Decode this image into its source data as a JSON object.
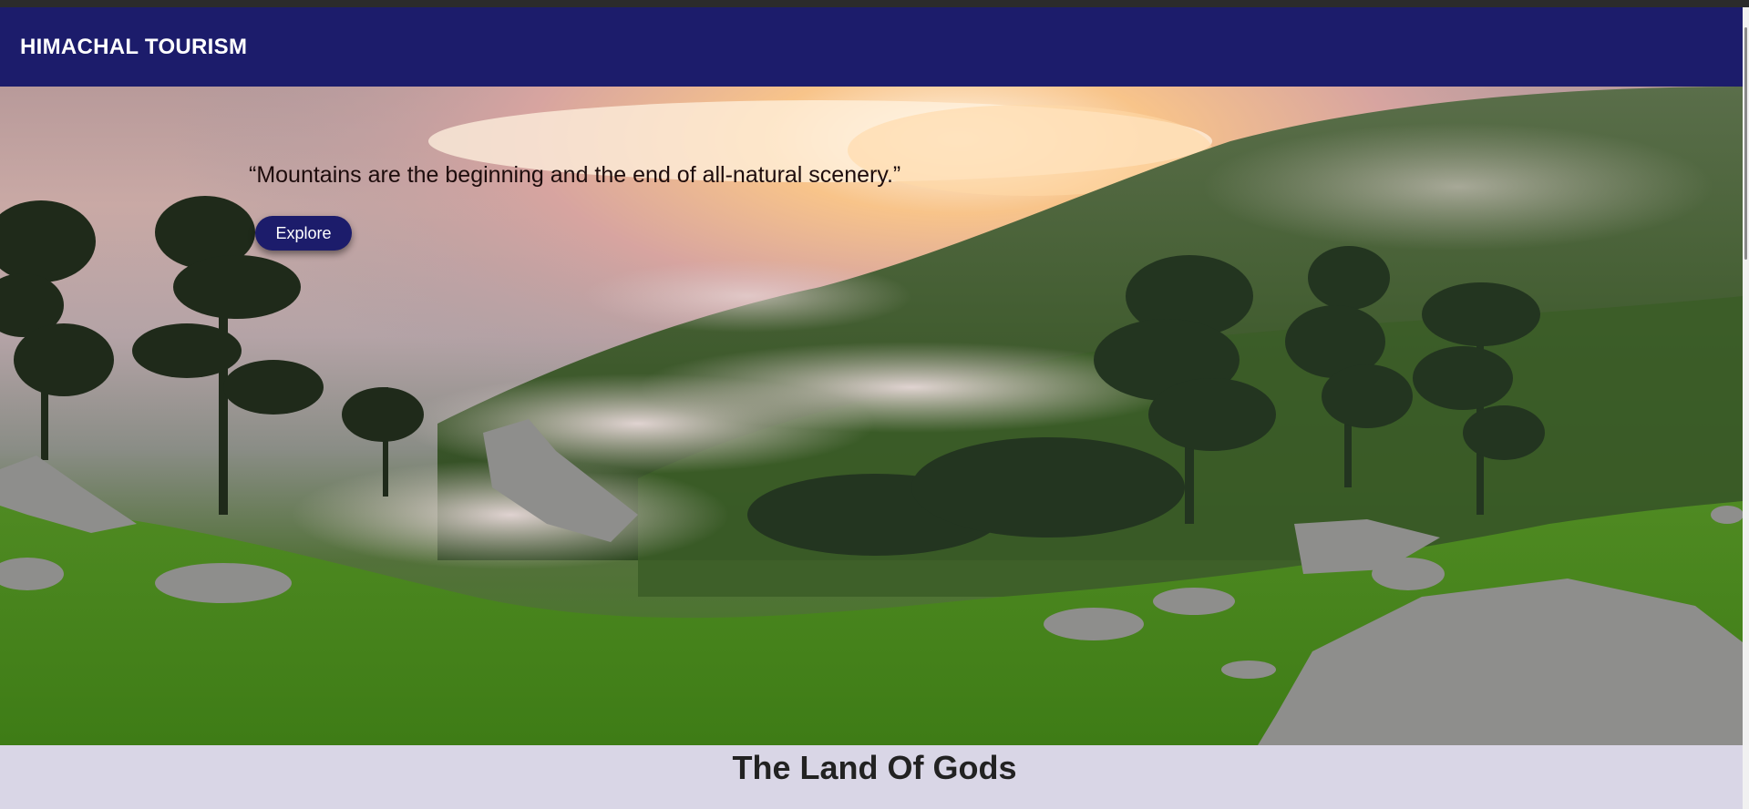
{
  "header": {
    "brand": "HIMACHAL TOURISM"
  },
  "hero": {
    "quote": "“Mountains are the beginning and the end of all-natural scenery.”",
    "explore_label": "Explore"
  },
  "section": {
    "title": "The Land Of Gods"
  },
  "colors": {
    "navbar": "#1c1c6b",
    "button": "#1c1c6b",
    "page_background": "#d9d6e6",
    "quote_text": "#1d0c0c"
  }
}
